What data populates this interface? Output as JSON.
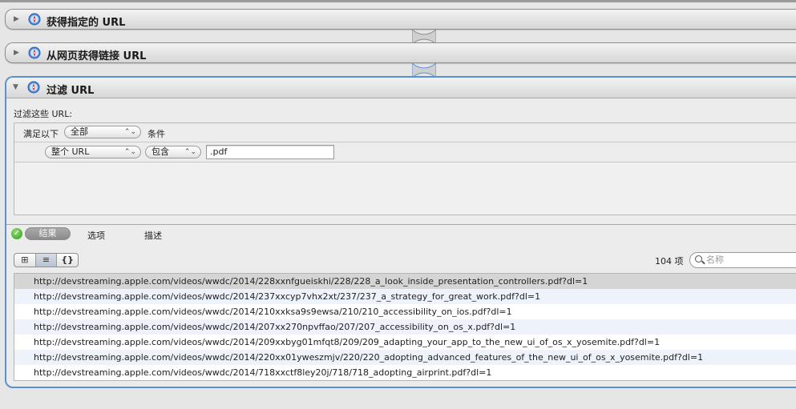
{
  "actions": [
    {
      "title": "获得指定的 URL",
      "icon": "automator-safari-icon"
    },
    {
      "title": "从网页获得链接 URL",
      "icon": "automator-safari-icon"
    }
  ],
  "filter_action": {
    "title": "过滤 URL",
    "icon": "automator-safari-icon",
    "label": "过滤这些 URL:",
    "match_prefix": "满足以下",
    "match_mode": "全部",
    "match_suffix": "条件",
    "rule": {
      "field": "整个 URL",
      "operator": "包含",
      "value": ".pdf"
    }
  },
  "tabs": {
    "results": "结果",
    "options": "选项",
    "description": "描述",
    "active": "结果"
  },
  "view_modes": [
    "⊞",
    "≡",
    "{}"
  ],
  "item_count": "104 项",
  "search": {
    "placeholder": "名称"
  },
  "results": [
    "http://devstreaming.apple.com/videos/wwdc/2014/228xxnfgueiskhi/228/228_a_look_inside_presentation_controllers.pdf?dl=1",
    "http://devstreaming.apple.com/videos/wwdc/2014/237xxcyp7vhx2xt/237/237_a_strategy_for_great_work.pdf?dl=1",
    "http://devstreaming.apple.com/videos/wwdc/2014/210xxksa9s9ewsa/210/210_accessibility_on_ios.pdf?dl=1",
    "http://devstreaming.apple.com/videos/wwdc/2014/207xx270npvffao/207/207_accessibility_on_os_x.pdf?dl=1",
    "http://devstreaming.apple.com/videos/wwdc/2014/209xxbyg01mfqt8/209/209_adapting_your_app_to_the_new_ui_of_os_x_yosemite.pdf?dl=1",
    "http://devstreaming.apple.com/videos/wwdc/2014/220xx01yweszmjv/220/220_adopting_advanced_features_of_the_new_ui_of_os_x_yosemite.pdf?dl=1",
    "http://devstreaming.apple.com/videos/wwdc/2014/718xxctf8ley20j/718/718_adopting_airprint.pdf?dl=1"
  ],
  "colors": {
    "accent": "#5b8fd6",
    "selected_row": "#d5d5d5",
    "stripe_row": "#eef3fb",
    "success": "#2e9b1f"
  }
}
